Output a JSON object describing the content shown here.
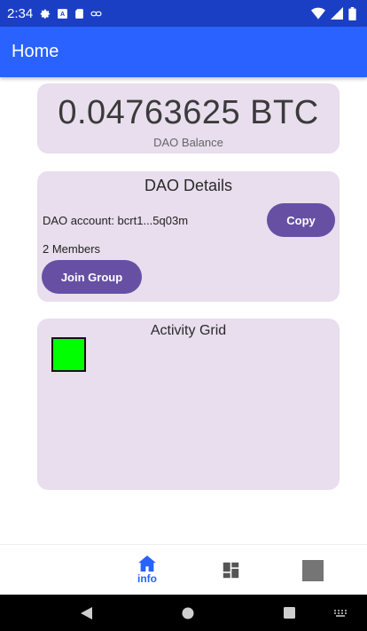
{
  "status_bar": {
    "time": "2:34",
    "icons": [
      "settings-icon",
      "notification-icon",
      "sd-card-icon",
      "link-icon"
    ],
    "right_icons": [
      "wifi-icon",
      "signal-icon",
      "battery-icon"
    ]
  },
  "app_bar": {
    "title": "Home"
  },
  "balance_card": {
    "value": "0.04763625 BTC",
    "label": "DAO Balance"
  },
  "details_card": {
    "title": "DAO Details",
    "account_text": "DAO account: bcrt1...5q03m",
    "copy_label": "Copy",
    "members_text": "2 Members",
    "join_label": "Join Group"
  },
  "activity_card": {
    "title": "Activity Grid",
    "cell_color": "#00ff00"
  },
  "bottom_nav": {
    "items": [
      {
        "label": "info",
        "icon": "home-icon",
        "active": true
      },
      {
        "label": "",
        "icon": "dashboard-icon",
        "active": false
      },
      {
        "label": "",
        "icon": "square-icon",
        "active": false
      }
    ]
  },
  "colors": {
    "status_bar": "#1b3fc4",
    "app_bar": "#2962ff",
    "card": "#e8deed",
    "button": "#6750a4",
    "nav_active": "#2962ff"
  }
}
